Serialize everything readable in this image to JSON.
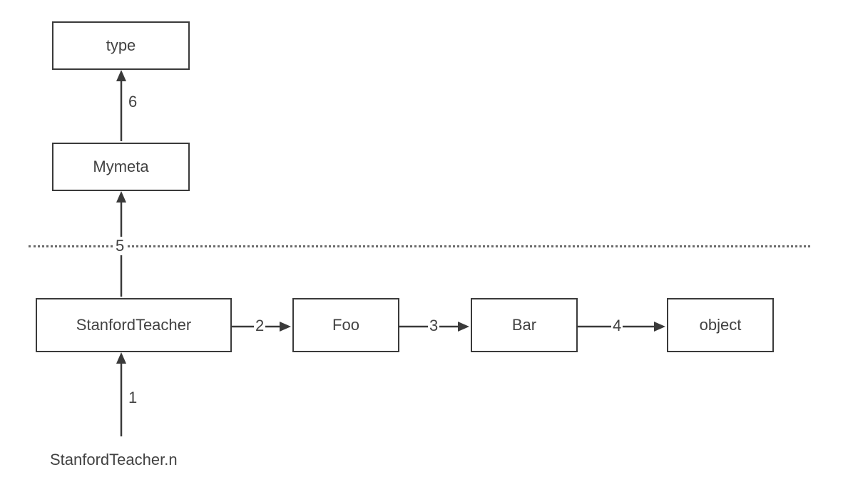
{
  "nodes": {
    "type": {
      "label": "type"
    },
    "mymeta": {
      "label": "Mymeta"
    },
    "stanfordteacher": {
      "label": "StanfordTeacher"
    },
    "foo": {
      "label": "Foo"
    },
    "bar": {
      "label": "Bar"
    },
    "object": {
      "label": "object"
    }
  },
  "edges": {
    "e1": {
      "label": "1"
    },
    "e2": {
      "label": "2"
    },
    "e3": {
      "label": "3"
    },
    "e4": {
      "label": "4"
    },
    "e5": {
      "label": "5"
    },
    "e6": {
      "label": "6"
    }
  },
  "free_text": {
    "bottom": "StanfordTeacher.n"
  }
}
